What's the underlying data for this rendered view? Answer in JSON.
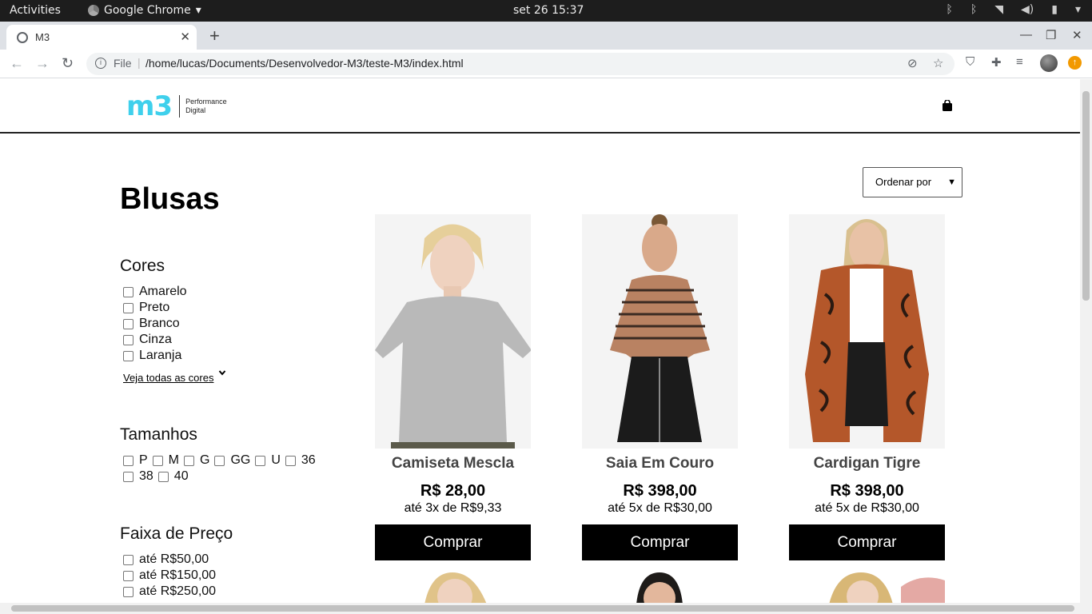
{
  "os": {
    "activities": "Activities",
    "app_name": "Google Chrome",
    "clock": "set 26  15:37"
  },
  "browser": {
    "tab_title": "M3",
    "url_scheme": "File",
    "url": "/home/lucas/Documents/Desenvolvedor-M3/teste-M3/index.html"
  },
  "site": {
    "logo_text": "m3",
    "logo_tagline_1": "Performance",
    "logo_tagline_2": "Digital",
    "brand_color": "#3fd0ec"
  },
  "page": {
    "title": "Blusas",
    "sort_label": "Ordenar por"
  },
  "filters": {
    "colors": {
      "title": "Cores",
      "options": [
        "Amarelo",
        "Preto",
        "Branco",
        "Cinza",
        "Laranja"
      ],
      "see_all": "Veja todas as cores"
    },
    "sizes": {
      "title": "Tamanhos",
      "options": [
        "P",
        "M",
        "G",
        "GG",
        "U",
        "36",
        "38",
        "40"
      ]
    },
    "price": {
      "title": "Faixa de Preço",
      "options": [
        "até R$50,00",
        "até R$150,00",
        "até R$250,00"
      ]
    }
  },
  "products": [
    {
      "name": "Camiseta Mescla",
      "price": "R$ 28,00",
      "installments": "até 3x de R$9,33",
      "buy": "Comprar"
    },
    {
      "name": "Saia Em Couro",
      "price": "R$ 398,00",
      "installments": "até 5x de R$30,00",
      "buy": "Comprar"
    },
    {
      "name": "Cardigan Tigre",
      "price": "R$ 398,00",
      "installments": "até 5x de R$30,00",
      "buy": "Comprar"
    }
  ]
}
